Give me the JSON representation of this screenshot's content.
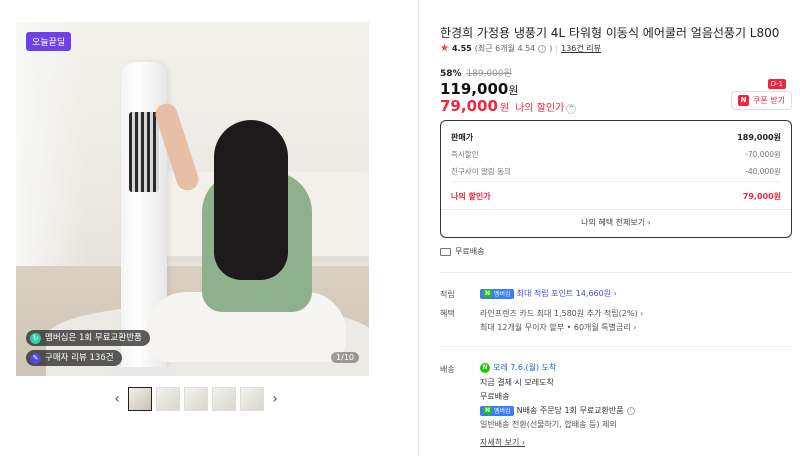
{
  "gallery": {
    "badge": "오늘끝딜",
    "pill_membership": "멤버십은 1회 무료교환반품",
    "pill_reviews": "구매자 리뷰 136건",
    "counter": "1/10",
    "prev_arrow": "‹",
    "next_arrow": "›",
    "thumb_count": 5
  },
  "product": {
    "title": "한경희 가정용 냉풍기 4L 타워형 이동식 에어쿨러 얼음선풍기 L800",
    "rating": "4.55",
    "recent_rating": "(최근 6개월 4.54",
    "review_count": "136건 리뷰",
    "discount_pct": "58%",
    "original_price": "189,000원",
    "price": "119,000",
    "my_price": "79,000",
    "won": "원",
    "my_price_label": "나의 할인가",
    "dday": "D-1",
    "coupon_label": "쿠폰 받기"
  },
  "breakdown": {
    "rows": [
      {
        "label": "판매가",
        "value": "189,000원"
      },
      {
        "label": "즉시할인",
        "value": "-70,000원"
      },
      {
        "label": "친구사이 알림 동의",
        "value": "-40,000원"
      }
    ],
    "my_label": "나의 할인가",
    "my_value": "79,000원",
    "footer": "나의 혜택 전체보기 ›"
  },
  "shipping_free": "무료배송",
  "info": {
    "points_label": "적립",
    "points_text": "최대 적립 포인트 14,660원 ›",
    "benefit_label": "혜택",
    "benefit_line1": "라인프렌즈 카드 최대 1,580원 추가 적립(2%) ›",
    "benefit_line2": "최대 12개월 무이자 할부 • 60개월 특별금리 ›",
    "delivery_label": "배송",
    "delivery_arrival": "모레 7.6.(월) 도착",
    "delivery_pay": "지금 결제 시 모레도착",
    "delivery_free": "무료배송",
    "delivery_return": "N배송 주문당 1회 무료교환반품",
    "delivery_general": "일반배송 전환(선물하기, 합배송 등) 제외",
    "detail_link": "자세히 보기 ›",
    "membership_tag": "멤버십"
  }
}
